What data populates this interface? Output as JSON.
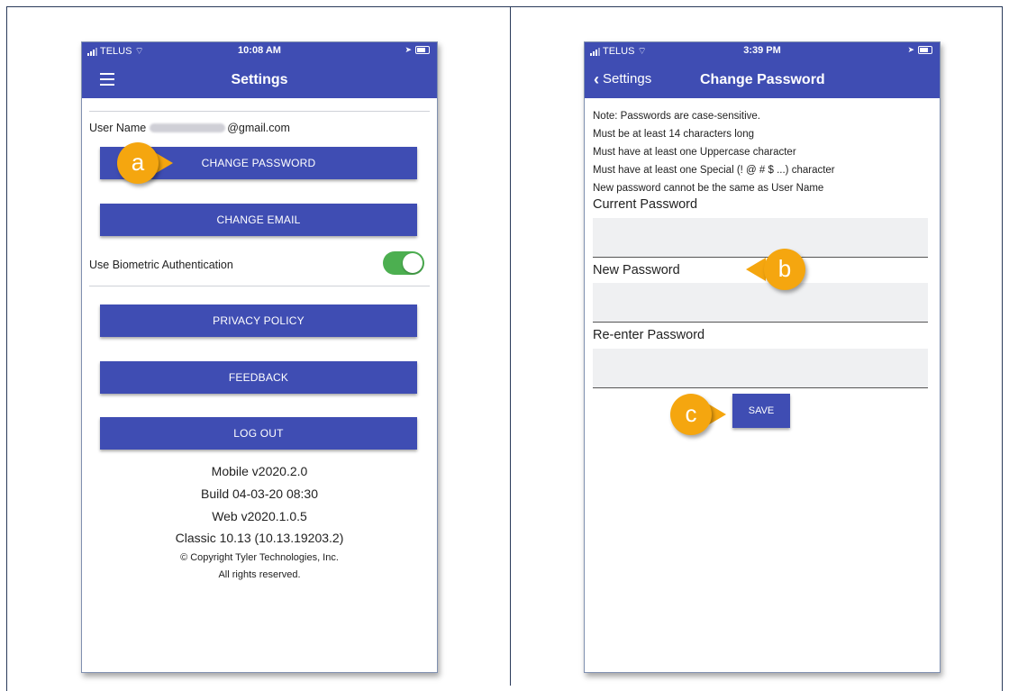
{
  "left_phone": {
    "status": {
      "carrier": "TELUS",
      "time": "10:08 AM"
    },
    "title": "Settings",
    "user_name_label": "User Name",
    "user_email_suffix": "@gmail.com",
    "buttons": {
      "change_password": "CHANGE PASSWORD",
      "change_email": "CHANGE EMAIL",
      "privacy_policy": "PRIVACY POLICY",
      "feedback": "FEEDBACK",
      "log_out": "LOG OUT"
    },
    "biometric_label": "Use Biometric Authentication",
    "biometric_enabled": true,
    "version": {
      "mobile": "Mobile v2020.2.0",
      "build": "Build 04-03-20 08:30",
      "web": "Web v2020.1.0.5",
      "classic": "Classic 10.13 (10.13.19203.2)",
      "copyright": "©   Copyright Tyler Technologies, Inc.",
      "rights": "All rights reserved."
    }
  },
  "right_phone": {
    "status": {
      "carrier": "TELUS",
      "time": "3:39 PM"
    },
    "back_label": "Settings",
    "title": "Change Password",
    "notes": [
      "Note: Passwords are case-sensitive.",
      "Must be at least  14  characters long",
      "Must have at least one Uppercase character",
      "Must have at least one Special (! @ # $ ...) character",
      "New password cannot be the same as User Name"
    ],
    "current_password_label": "Current Password",
    "new_password_label": "New Password",
    "reenter_password_label": "Re-enter Password",
    "save_label": "SAVE"
  },
  "callouts": {
    "a": "a",
    "b": "b",
    "c": "c"
  },
  "colors": {
    "appbar": "#3f4db3",
    "button": "#3f4db3",
    "toggle_on": "#4caf50",
    "callout": "#f5a60f"
  }
}
